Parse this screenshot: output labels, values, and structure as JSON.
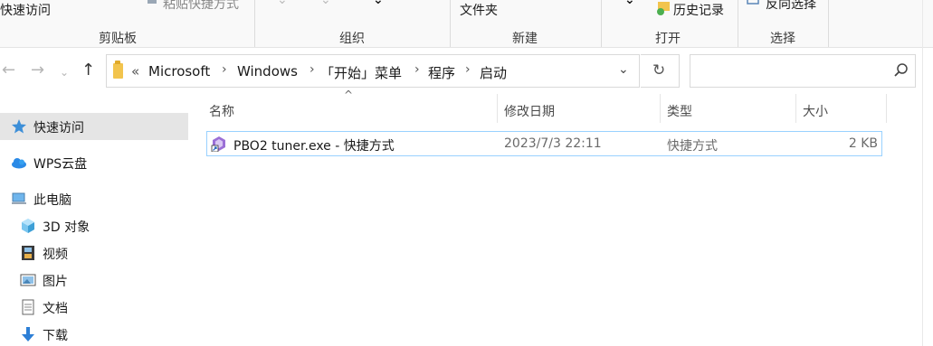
{
  "ribbon": {
    "quick_access_label": "快速访问",
    "paste_shortcut_label": "粘贴快捷方式",
    "new_folder_label": "文件夹",
    "history_label": "历史记录",
    "invert_selection_label": "反向选择",
    "groups": {
      "clipboard": "剪贴板",
      "organize": "组织",
      "new": "新建",
      "open": "打开",
      "select": "选择"
    }
  },
  "address": {
    "overflow": "«",
    "crumbs": [
      "Microsoft",
      "Windows",
      "「开始」菜单",
      "程序",
      "启动"
    ],
    "separator": "›"
  },
  "search": {
    "placeholder": "",
    "value": ""
  },
  "nav": {
    "quick_access": "快速访问",
    "wps_cloud": "WPS云盘",
    "this_pc": "此电脑",
    "objects_3d": "3D 对象",
    "videos": "视频",
    "pictures": "图片",
    "documents": "文档",
    "downloads": "下载"
  },
  "columns": {
    "name": "名称",
    "modified": "修改日期",
    "type": "类型",
    "size": "大小"
  },
  "files": [
    {
      "name": "PBO2 tuner.exe - 快捷方式",
      "modified": "2023/7/3 22:11",
      "type": "快捷方式",
      "size": "2 KB"
    }
  ],
  "colors": {
    "selection": "#cce8ff",
    "row_border": "#99d1ff",
    "folder": "#f2c44d"
  }
}
